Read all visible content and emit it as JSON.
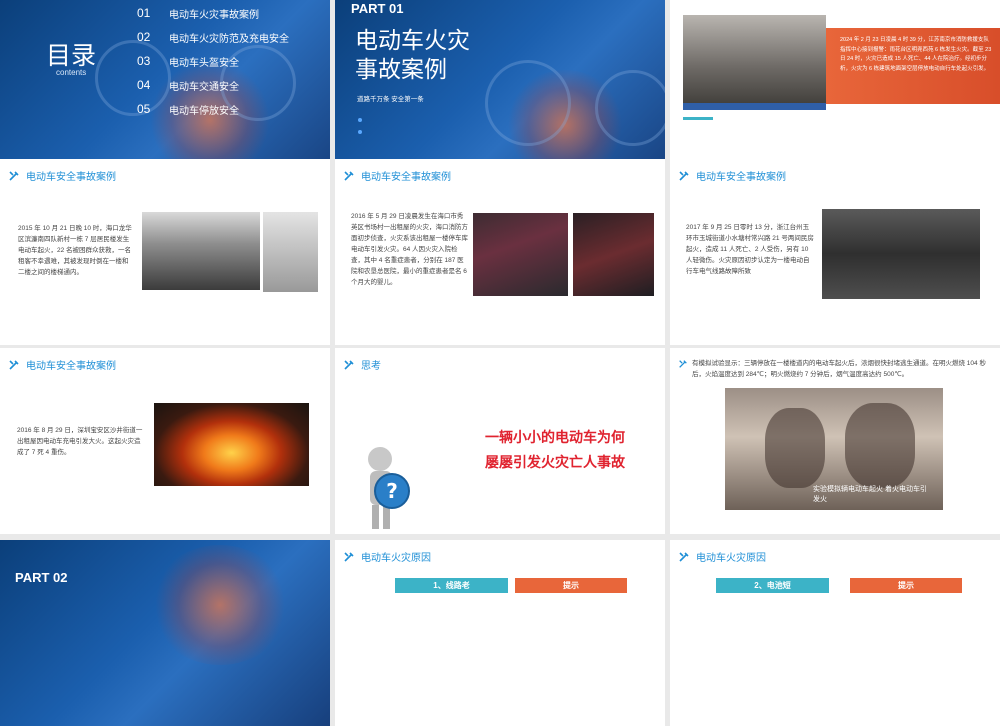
{
  "toc": {
    "title": "目录",
    "subtitle": "contents",
    "items": [
      {
        "num": "01",
        "label": "电动车火灾事故案例"
      },
      {
        "num": "02",
        "label": "电动车火灾防范及充电安全"
      },
      {
        "num": "03",
        "label": "电动车头盔安全"
      },
      {
        "num": "04",
        "label": "电动车交通安全"
      },
      {
        "num": "05",
        "label": "电动车停放安全"
      }
    ]
  },
  "part1": {
    "part": "PART 01",
    "title_line1": "电动车火灾",
    "title_line2": "事故案例",
    "tagline": "道路千万条 安全第一条"
  },
  "slide3": {
    "text": "2024 年 2 月 23 日凌晨 4 时 39 分，江苏南京市消防救援支队指挥中心接到报警：雨花台区明尧西苑 6 栋发生火灾。截至 23 日 24 时，火灾已造成 15 人死亡、44 人在院治疗。经初步分析，火灾为 6 栋建筑地面架空层停放电动自行车处起火引发。"
  },
  "heading_case": "电动车安全事故案例",
  "slide4": {
    "text": "2015 年 10 月 21 日晚 10 时，海口龙华区滨濂南四队新村一栋 7 层居民楼发生电动车起火，22 名被困群众获救，一名租客不幸遇难，其被发现时倒在一楼和二楼之间的楼梯通内。"
  },
  "slide5": {
    "text": "2016 年 5 月 29 日凌晨发生在海口市秀英区书场村一出租屋的火灾，海口消防方面初步侦查，火灾系该出租屋一楼停车库电动车引发火灾。64 人因火灾入院检查，其中 4 名重症患者，分别在 187 医院和农垦总医院，最小的重症患者是名 6 个月大的婴儿。"
  },
  "slide6": {
    "text": "2017 年 9 月 25 日零时 13 分，浙江台州玉环市玉城街道小水塘村常兴路 21 号两间民房起火，造成 11 人死亡、2 人受伤，另有 10 人轻微伤。火灾原因初步认定为一楼电动自行车电气线路故障所致"
  },
  "slide7": {
    "text": "2016 年 8 月 29 日，深圳宝安区沙井街道一出租屋因电动车充电引发大火。这起火灾造成了 7 死 4 重伤。"
  },
  "slide8": {
    "heading": "思考",
    "line1": "一辆小小的电动车为何",
    "line2": "屡屡引发火灾亡人事故"
  },
  "slide9": {
    "text": "有模拟试验显示：三辆停放在一楼楼道内的电动车起火后，浓烟很快封堵逃生通道。在明火燃烧 104 秒后，火焰温度达到 284℃；明火燃烧约 7 分钟后，烟气温度高达约 500℃。",
    "caption": "实验模拟辆电动车起火 着火电动车引发火"
  },
  "part2": {
    "part": "PART 02"
  },
  "heading_cause": "电动车火灾原因",
  "slide11": {
    "box1": "1、线路老",
    "box2": "提示"
  },
  "slide12": {
    "box1": "2、电池短",
    "box2": "提示"
  },
  "colors": {
    "accent": "#1f8fd6",
    "red": "#e0232f",
    "orange": "#e8663a",
    "teal": "#3cb3c7"
  }
}
